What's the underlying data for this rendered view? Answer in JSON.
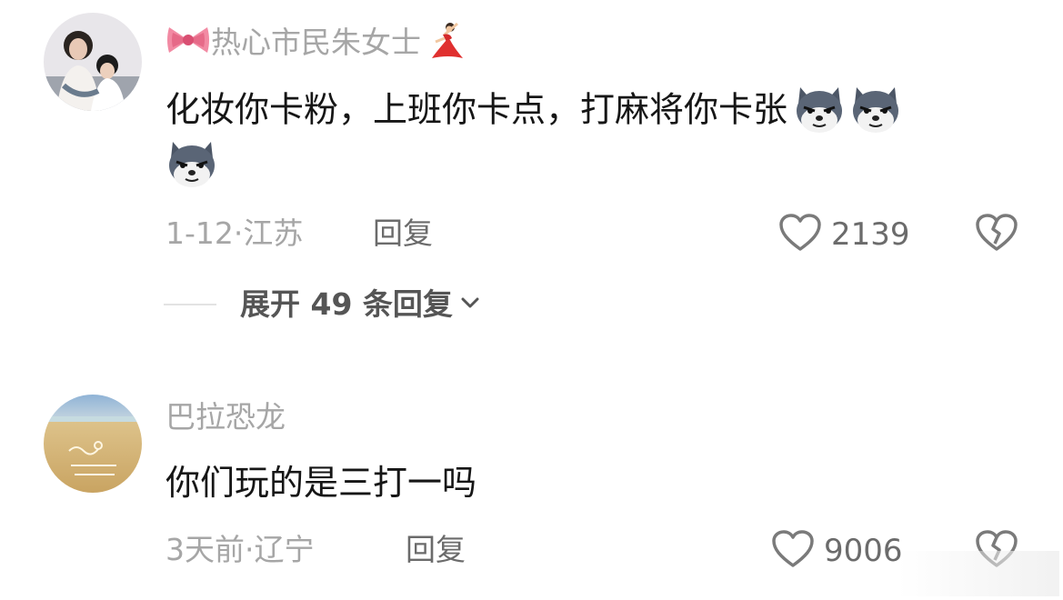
{
  "comments": [
    {
      "username": "热心市民朱女士",
      "username_prefix_icon": "bow-emoji",
      "username_suffix_icon": "dancer-emoji",
      "text": "化妆你卡粉，上班你卡点，打麻将你卡张",
      "stickers": [
        "husky-sticker",
        "husky-sticker",
        "husky-sticker"
      ],
      "date_location": "1-12·江苏",
      "reply_label": "回复",
      "likes": "2139",
      "expand_label": "展开 49 条回复"
    },
    {
      "username": "巴拉恐龙",
      "text": "你们玩的是三打一吗",
      "date_location": "3天前·辽宁",
      "reply_label": "回复",
      "likes": "9006"
    }
  ],
  "colors": {
    "username": "#a6a6a6",
    "text": "#161616",
    "meta": "#a6a6a6",
    "action": "#6b6b6b"
  }
}
